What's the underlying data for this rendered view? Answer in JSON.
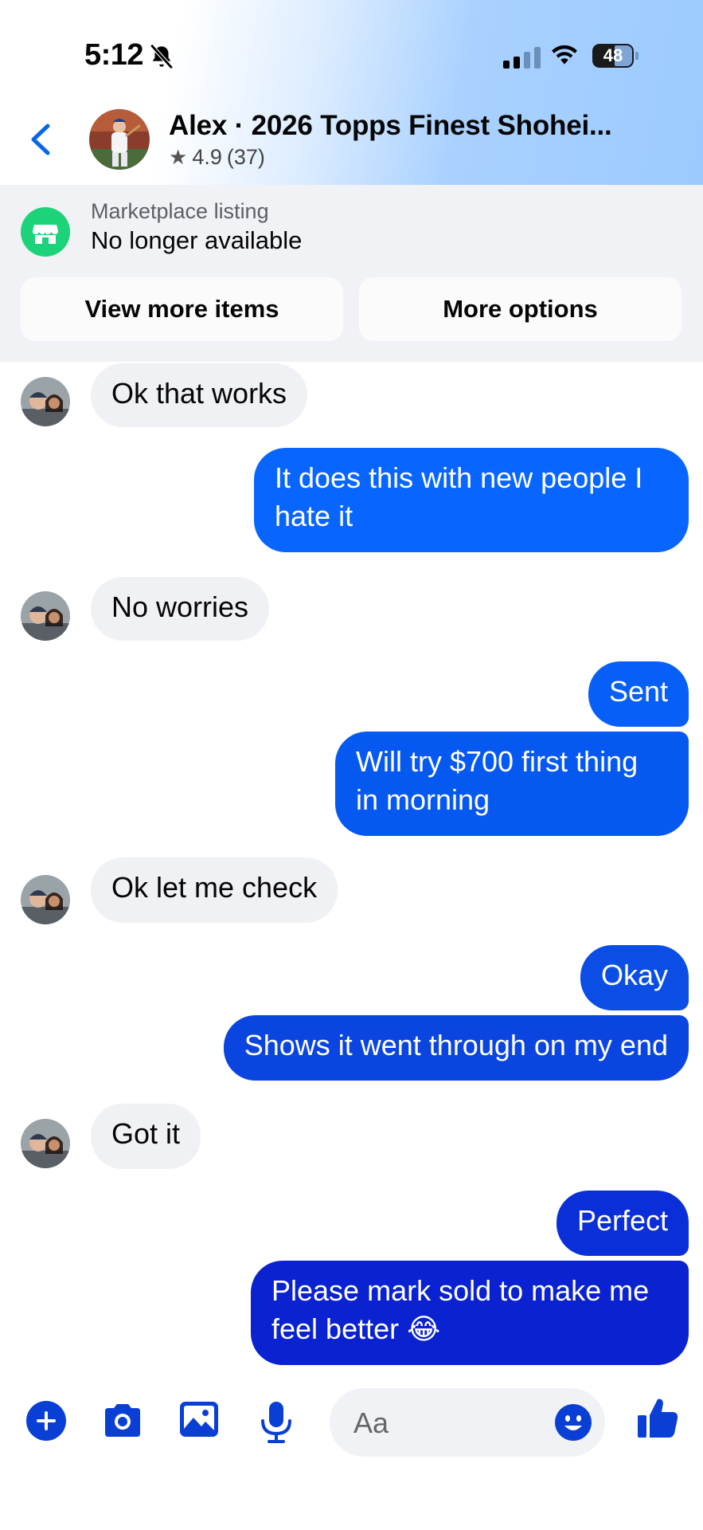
{
  "status_bar": {
    "time": "5:12",
    "battery": "48"
  },
  "header": {
    "title": "Alex · 2026 Topps Finest Shohei...",
    "rating": "4.9",
    "rating_count": "(37)"
  },
  "marketplace": {
    "label": "Marketplace listing",
    "status": "No longer available",
    "view_more_label": "View more items",
    "more_options_label": "More options"
  },
  "messages": [
    {
      "direction": "incoming",
      "text": "Ok that works"
    },
    {
      "direction": "outgoing",
      "text": "It does this with new people I hate it"
    },
    {
      "direction": "incoming",
      "text": "No worries"
    },
    {
      "direction": "outgoing",
      "text": "Sent"
    },
    {
      "direction": "outgoing",
      "text": "Will try $700 first thing in morning"
    },
    {
      "direction": "incoming",
      "text": "Ok let me check"
    },
    {
      "direction": "outgoing",
      "text": "Okay"
    },
    {
      "direction": "outgoing",
      "text": "Shows it went through on my end"
    },
    {
      "direction": "incoming",
      "text": "Got it"
    },
    {
      "direction": "outgoing",
      "text": "Perfect"
    },
    {
      "direction": "outgoing",
      "text": "Please mark sold to make me feel better 😂"
    }
  ],
  "composer": {
    "placeholder": "Aa"
  },
  "colors": {
    "accent": "#0a57e8",
    "outgoing_bubble_top": "#0866ff",
    "outgoing_bubble_bottom": "#0a1fce",
    "incoming_bubble": "#f0f1f4",
    "marketplace_green": "#1cd37a"
  },
  "icons": [
    "back-chevron-icon",
    "star-icon",
    "marketplace-store-icon",
    "plus-icon",
    "camera-icon",
    "gallery-icon",
    "microphone-icon",
    "emoji-icon",
    "thumbs-up-icon",
    "bell-off-icon",
    "wifi-icon"
  ]
}
